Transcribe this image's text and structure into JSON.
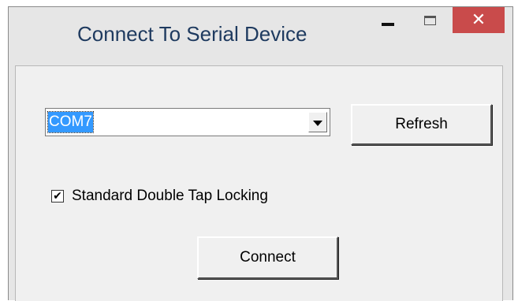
{
  "window": {
    "title": "Connect To Serial Device",
    "close_glyph": "✕",
    "close_color": "#c94b4b"
  },
  "port_select": {
    "selected_value": "COM7"
  },
  "refresh_button": {
    "label": "Refresh"
  },
  "locking_option": {
    "label": "Standard Double Tap Locking",
    "checked": true,
    "check_glyph": "✔"
  },
  "connect_button": {
    "label": "Connect"
  }
}
